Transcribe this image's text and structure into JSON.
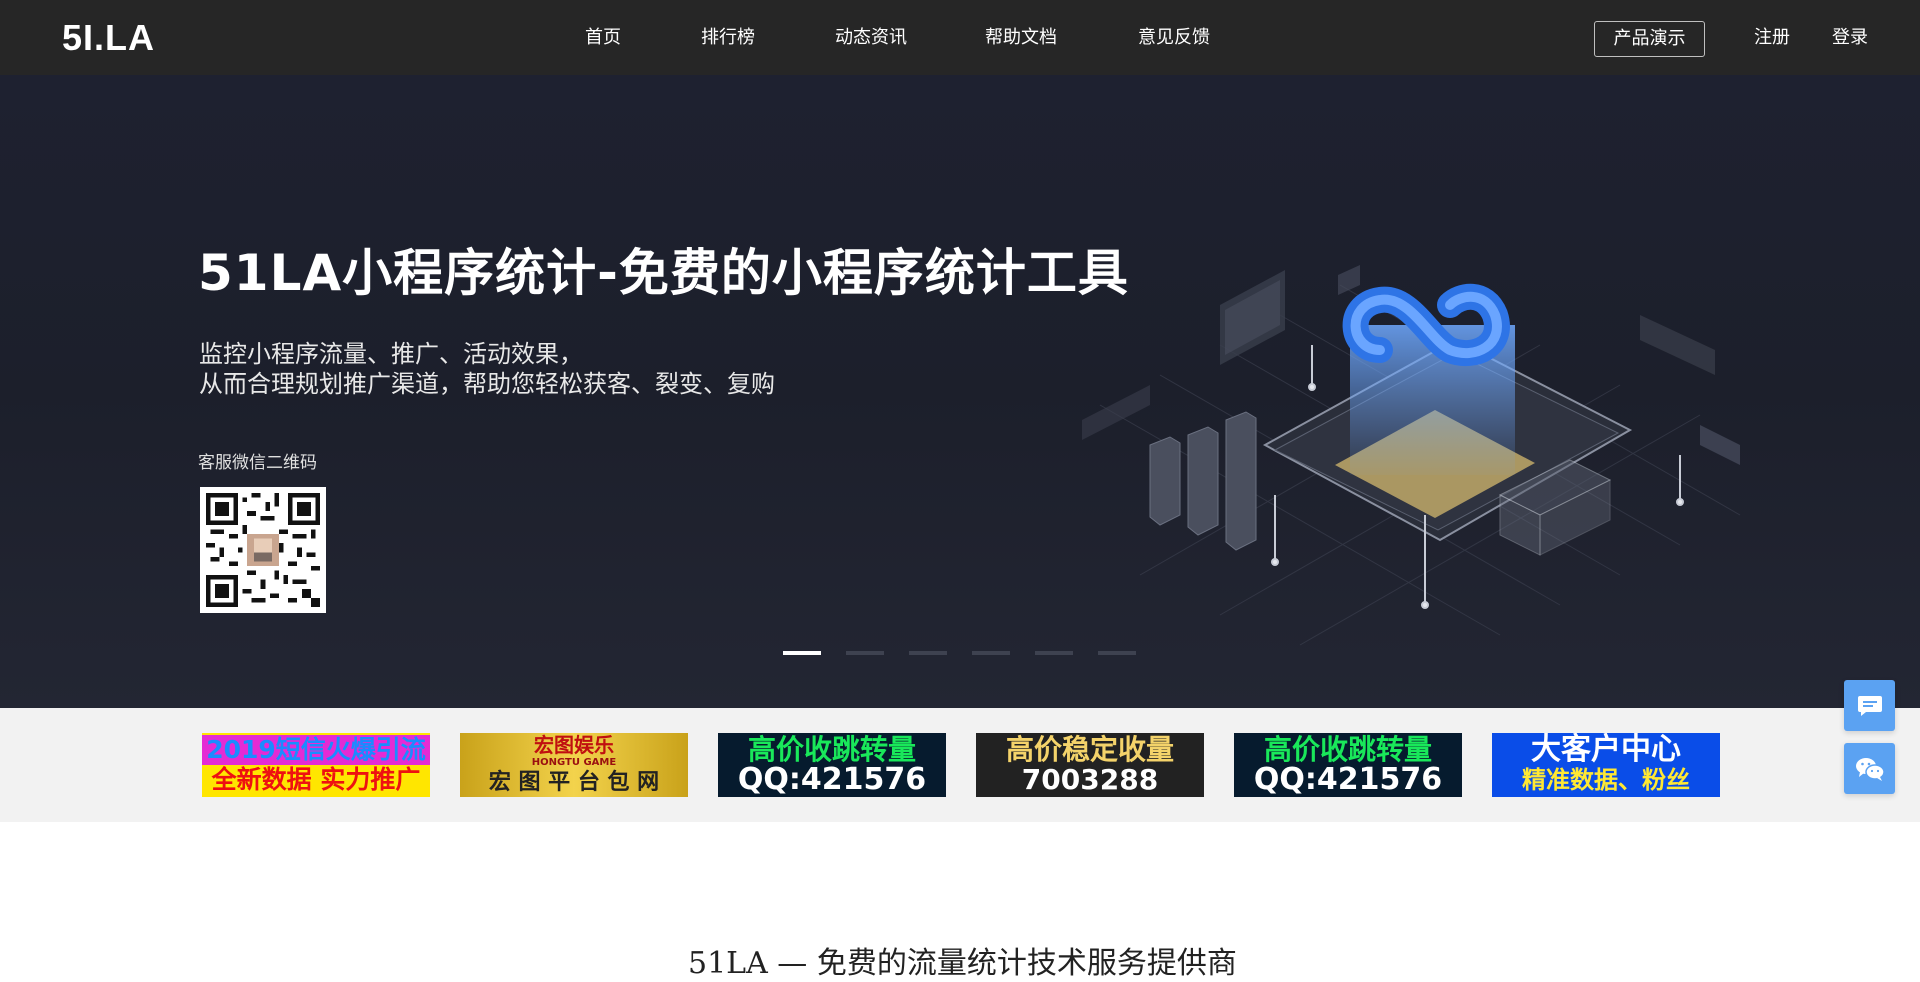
{
  "header": {
    "logo": "5I.LA",
    "nav": [
      "首页",
      "排行榜",
      "动态资讯",
      "帮助文档",
      "意见反馈"
    ],
    "demo_label": "产品演示",
    "register_label": "注册",
    "login_label": "登录"
  },
  "banner": {
    "title": "51LA小程序统计-免费的小程序统计工具",
    "subtitle_line1": "监控小程序流量、推广、活动效果，",
    "subtitle_line2": "从而合理规划推广渠道，帮助您轻松获客、裂变、复购",
    "qr_label": "客服微信二维码",
    "slides_total": 6,
    "active_slide": 1
  },
  "ads": [
    {
      "line1": "2019短信火爆引流",
      "line2": "全新数据 实力推广"
    },
    {
      "line1": "宏图娱乐",
      "line2": "宏 图 平 台 包 网",
      "small": "HONGTU GAME"
    },
    {
      "line1": "高价收跳转量",
      "line2": "QQ:421576"
    },
    {
      "line1": "高价稳定收量",
      "line2": "7003288"
    },
    {
      "line1": "高价收跳转量",
      "line2": "QQ:421576"
    },
    {
      "line1": "大客户中心",
      "line2": "精准数据、粉丝"
    }
  ],
  "bottom_title": "51LA — 免费的流量统计技术服务提供商",
  "colors": {
    "header_bg": "#262626",
    "banner_bg": "#1e2130",
    "accent_blue": "#5ba2f2"
  },
  "floating": {
    "chat_icon": "chat-bubble-icon",
    "wechat_icon": "wechat-icon"
  }
}
